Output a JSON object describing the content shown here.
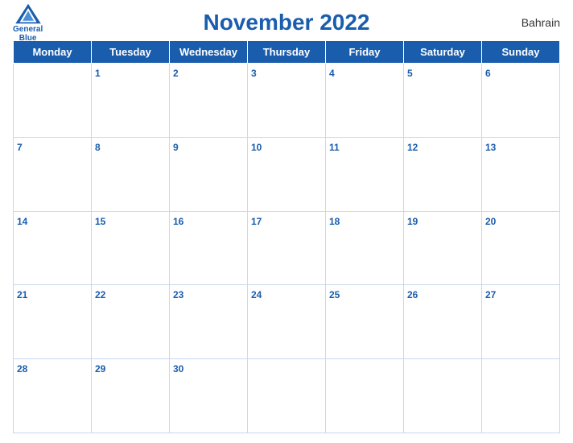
{
  "header": {
    "title": "November 2022",
    "country": "Bahrain",
    "logo": {
      "line1": "General",
      "line2": "Blue"
    }
  },
  "weekdays": [
    "Monday",
    "Tuesday",
    "Wednesday",
    "Thursday",
    "Friday",
    "Saturday",
    "Sunday"
  ],
  "weeks": [
    [
      "",
      "1",
      "2",
      "3",
      "4",
      "5",
      "6"
    ],
    [
      "7",
      "8",
      "9",
      "10",
      "11",
      "12",
      "13"
    ],
    [
      "14",
      "15",
      "16",
      "17",
      "18",
      "19",
      "20"
    ],
    [
      "21",
      "22",
      "23",
      "24",
      "25",
      "26",
      "27"
    ],
    [
      "28",
      "29",
      "30",
      "",
      "",
      "",
      ""
    ]
  ]
}
